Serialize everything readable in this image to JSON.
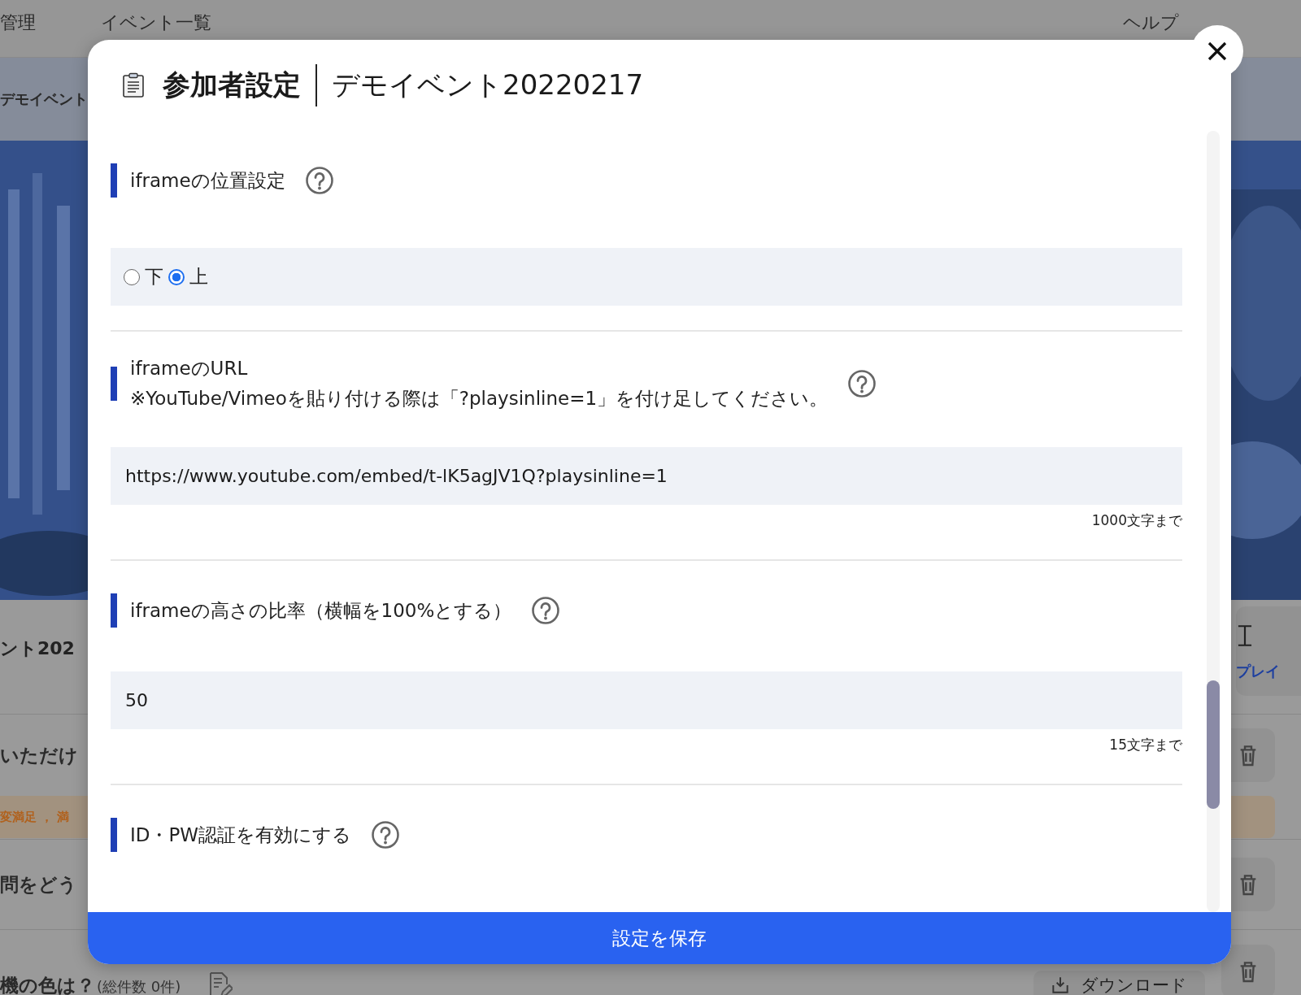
{
  "nav": {
    "items": [
      "管理",
      "イベント一覧"
    ],
    "help": "ヘルプ"
  },
  "breadcrumb": "デモイベント",
  "background": {
    "title": "ント202",
    "play_label": "プレイ",
    "row_1": "いただけ",
    "tag": "変満足 ， 満",
    "row_2": "問をどう",
    "row_3": "機の色は？",
    "row_3_count": "(総件数 0件)",
    "csv_label": "ダウンロード"
  },
  "modal": {
    "title": "参加者設定",
    "event": "デモイベント20220217",
    "sections": [
      {
        "kind": "radio",
        "label": "iframeの位置設定",
        "options": [
          {
            "label": "下",
            "selected": false
          },
          {
            "label": "上",
            "selected": true
          }
        ]
      },
      {
        "kind": "text",
        "label": "iframeのURL",
        "note": "※YouTube/Vimeoを貼り付ける際は「?playsinline=1」を付け足してください。",
        "value": "https://www.youtube.com/embed/t-lK5agJV1Q?playsinline=1",
        "limit": "1000文字まで"
      },
      {
        "kind": "text",
        "label": "iframeの高さの比率（横幅を100%とする）",
        "value": "50",
        "limit": "15文字まで"
      },
      {
        "kind": "heading",
        "label": "ID・PW認証を有効にする"
      }
    ],
    "save": "設定を保存"
  }
}
